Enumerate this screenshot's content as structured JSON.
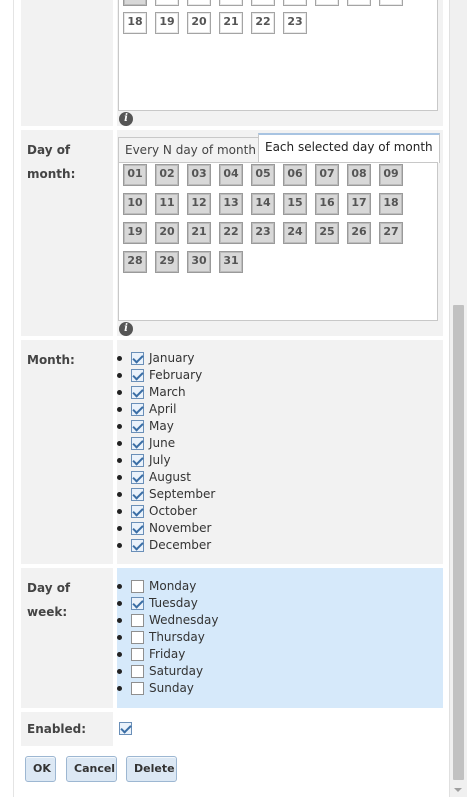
{
  "top_grid": {
    "partial_row": [
      "18",
      "19",
      "20",
      "21",
      "22",
      "23"
    ]
  },
  "day_of_month": {
    "label": "Day of month:",
    "tabs": [
      {
        "label": "Every N day of month",
        "active": false
      },
      {
        "label": "Each selected day of month",
        "active": true
      }
    ],
    "days": [
      "01",
      "02",
      "03",
      "04",
      "05",
      "06",
      "07",
      "08",
      "09",
      "10",
      "11",
      "12",
      "13",
      "14",
      "15",
      "16",
      "17",
      "18",
      "19",
      "20",
      "21",
      "22",
      "23",
      "24",
      "25",
      "26",
      "27",
      "28",
      "29",
      "30",
      "31"
    ]
  },
  "month": {
    "label": "Month:",
    "items": [
      {
        "label": "January",
        "checked": true
      },
      {
        "label": "February",
        "checked": true
      },
      {
        "label": "March",
        "checked": true
      },
      {
        "label": "April",
        "checked": true
      },
      {
        "label": "May",
        "checked": true
      },
      {
        "label": "June",
        "checked": true
      },
      {
        "label": "July",
        "checked": true
      },
      {
        "label": "August",
        "checked": true
      },
      {
        "label": "September",
        "checked": true
      },
      {
        "label": "October",
        "checked": true
      },
      {
        "label": "November",
        "checked": true
      },
      {
        "label": "December",
        "checked": true
      }
    ]
  },
  "day_of_week": {
    "label": "Day of week:",
    "items": [
      {
        "label": "Monday",
        "checked": false
      },
      {
        "label": "Tuesday",
        "checked": true
      },
      {
        "label": "Wednesday",
        "checked": false
      },
      {
        "label": "Thursday",
        "checked": false
      },
      {
        "label": "Friday",
        "checked": false
      },
      {
        "label": "Saturday",
        "checked": false
      },
      {
        "label": "Sunday",
        "checked": false
      }
    ]
  },
  "enabled": {
    "label": "Enabled:",
    "checked": true
  },
  "buttons": {
    "ok": "OK",
    "cancel": "Cancel",
    "delete": "Delete"
  },
  "info_icon": "info-icon",
  "colors": {
    "selected_row_bg": "#d6e9fa",
    "button_bg": "#dce8f4"
  }
}
